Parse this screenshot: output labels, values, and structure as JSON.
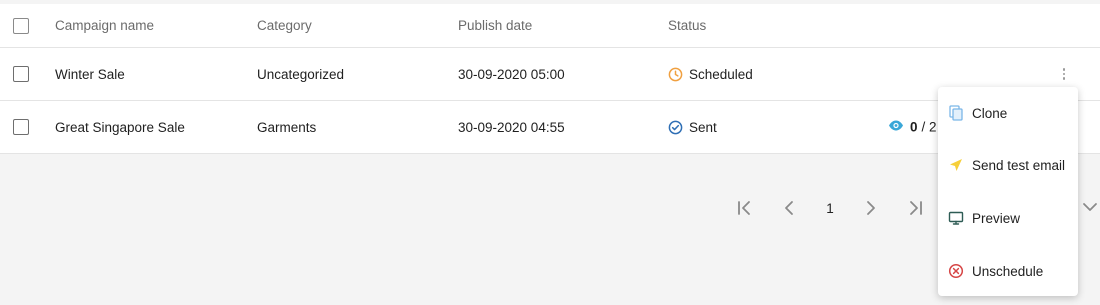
{
  "table": {
    "headers": {
      "name": "Campaign name",
      "category": "Category",
      "publish_date": "Publish date",
      "status": "Status"
    },
    "rows": [
      {
        "name": "Winter Sale",
        "category": "Uncategorized",
        "publish_date": "30-09-2020 05:00",
        "status": "Scheduled",
        "status_icon": "clock-icon",
        "status_color": "#f0a040"
      },
      {
        "name": "Great Singapore Sale",
        "category": "Garments",
        "publish_date": "30-09-2020 04:55",
        "status": "Sent",
        "status_icon": "check-circle-icon",
        "status_color": "#2f6fb5",
        "views_count": "0",
        "views_suffix": "/ 2"
      }
    ]
  },
  "pagination": {
    "current_page": "1"
  },
  "context_menu": {
    "items": [
      {
        "label": "Clone",
        "icon": "copy-icon"
      },
      {
        "label": "Send test email",
        "icon": "send-icon"
      },
      {
        "label": "Preview",
        "icon": "monitor-icon"
      },
      {
        "label": "Unschedule",
        "icon": "cancel-circle-icon"
      }
    ]
  },
  "colors": {
    "eye": "#3aa7d8",
    "send": "#f6cf3a",
    "copy": "#7bb6e8",
    "monitor": "#2e5c55",
    "cancel": "#d64545"
  }
}
